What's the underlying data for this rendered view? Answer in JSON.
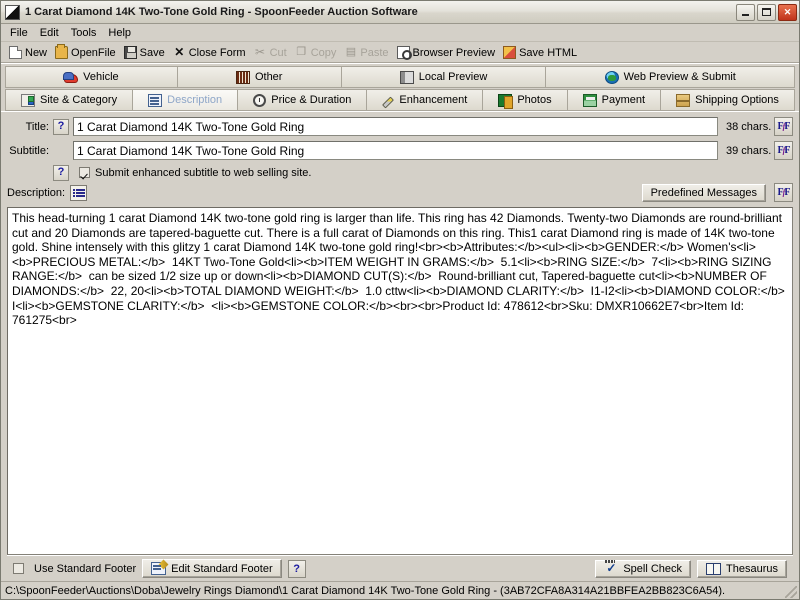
{
  "window": {
    "title": "1 Carat Diamond 14K Two-Tone Gold Ring - SpoonFeeder Auction Software",
    "app_icon": "document-app-icon",
    "minimize_label": "",
    "maximize_label": "",
    "close_label": "✕"
  },
  "menubar": {
    "items": [
      {
        "label": "File"
      },
      {
        "label": "Edit"
      },
      {
        "label": "Tools"
      },
      {
        "label": "Help"
      }
    ]
  },
  "toolbar": {
    "buttons": [
      {
        "label": "New",
        "icon": "new-document-icon",
        "enabled": true
      },
      {
        "label": "OpenFile",
        "icon": "open-folder-icon",
        "enabled": true
      },
      {
        "label": "Save",
        "icon": "floppy-disk-icon",
        "enabled": true
      },
      {
        "label": "Close Form",
        "icon": "close-x-icon",
        "enabled": true
      },
      {
        "label": "Cut",
        "icon": "scissors-icon",
        "enabled": false
      },
      {
        "label": "Copy",
        "icon": "copy-pages-icon",
        "enabled": false
      },
      {
        "label": "Paste",
        "icon": "clipboard-paste-icon",
        "enabled": false
      },
      {
        "label": "Browser Preview",
        "icon": "magnifier-page-icon",
        "enabled": true
      },
      {
        "label": "Save HTML",
        "icon": "html-file-icon",
        "enabled": true
      }
    ]
  },
  "tabs_top": [
    {
      "label": "Vehicle",
      "icon": "car-icon",
      "active": false
    },
    {
      "label": "Other",
      "icon": "barcode-icon",
      "active": false
    },
    {
      "label": "Local Preview",
      "icon": "window-preview-icon",
      "active": false
    },
    {
      "label": "Web Preview & Submit",
      "icon": "globe-icon",
      "active": false
    }
  ],
  "tabs_bottom": [
    {
      "label": "Site & Category",
      "icon": "sitemap-icon",
      "active": false
    },
    {
      "label": "Description",
      "icon": "description-page-icon",
      "active": true
    },
    {
      "label": "Price & Duration",
      "icon": "clock-icon",
      "active": false
    },
    {
      "label": "Enhancement",
      "icon": "magic-wand-icon",
      "active": false
    },
    {
      "label": "Photos",
      "icon": "photos-icon",
      "active": false
    },
    {
      "label": "Payment",
      "icon": "payment-card-icon",
      "active": false
    },
    {
      "label": "Shipping Options",
      "icon": "package-box-icon",
      "active": false
    }
  ],
  "form": {
    "title_field": {
      "label": "Title:",
      "help_icon": "question-mark-icon",
      "value": "1 Carat Diamond 14K Two-Tone Gold Ring",
      "char_count": "38 chars.",
      "font_button": "font-format-icon"
    },
    "subtitle_field": {
      "label": "Subtitle:",
      "value": "1 Carat Diamond 14K Two-Tone Gold Ring",
      "char_count": "39 chars.",
      "font_button": "font-format-icon"
    },
    "enhanced_subtitle": {
      "help_icon": "question-mark-icon",
      "label": "Submit enhanced subtitle to web selling site.",
      "checked": true
    },
    "description": {
      "label": "Description:",
      "list_button": "bullet-list-icon",
      "predefined_messages_label": "Predefined Messages",
      "font_button": "font-format-icon",
      "text": "This head-turning 1 carat Diamond 14K two-tone gold ring is larger than life. This ring has 42 Diamonds. Twenty-two Diamonds are round-brilliant cut and 20 Diamonds are tapered-baguette cut. There is a full carat of Diamonds on this ring. This1 carat Diamond ring is made of 14K two-tone gold. Shine intensely with this glitzy 1 carat Diamond 14K two-tone gold ring!<br><b>Attributes:</b><ul><li><b>GENDER:</b> Women's<li><b>PRECIOUS METAL:</b>  14KT Two-Tone Gold<li><b>ITEM WEIGHT IN GRAMS:</b>  5.1<li><b>RING SIZE:</b>  7<li><b>RING SIZING RANGE:</b>  can be sized 1/2 size up or down<li><b>DIAMOND CUT(S):</b>  Round-brilliant cut, Tapered-baguette cut<li><b>NUMBER OF DIAMONDS:</b>  22, 20<li><b>TOTAL DIAMOND WEIGHT:</b>  1.0 cttw<li><b>DIAMOND CLARITY:</b>  I1-I2<li><b>DIAMOND COLOR:</b>  I<li><b>GEMSTONE CLARITY:</b>  <li><b>GEMSTONE COLOR:</b><br><br>Product Id: 478612<br>Sku: DMXR10662E7<br>Item Id: 761275<br>"
    }
  },
  "footer": {
    "use_standard_footer": {
      "label": "Use Standard Footer",
      "checked": false
    },
    "edit_standard_footer": {
      "label": "Edit Standard Footer",
      "icon": "edit-page-icon"
    },
    "help_button": {
      "icon": "question-mark-icon"
    },
    "spell_check": {
      "label": "Spell Check",
      "icon": "spell-check-icon"
    },
    "thesaurus": {
      "label": "Thesaurus",
      "icon": "book-icon"
    }
  },
  "statusbar": {
    "path": "C:\\SpoonFeeder\\Auctions\\Doba\\Jewelry Rings Diamond\\1 Carat Diamond 14K Two-Tone Gold Ring - (3AB72CFA8A314A21BBFEA2BB823C6A54)."
  }
}
